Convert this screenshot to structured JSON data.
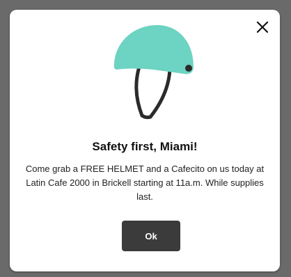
{
  "modal": {
    "title": "Safety first, Miami!",
    "message": "Come grab a FREE HELMET and a Cafecito on us today at Latin Cafe 2000 in Brickell starting at 11a.m. While supplies last.",
    "ok_label": "Ok",
    "close_icon": "close-icon",
    "helmet_icon": "helmet-icon"
  },
  "colors": {
    "helmet": "#6dd3c2",
    "strap": "#2b2b2b",
    "button": "#3b3b3b",
    "overlay": "#6a6a6a"
  }
}
